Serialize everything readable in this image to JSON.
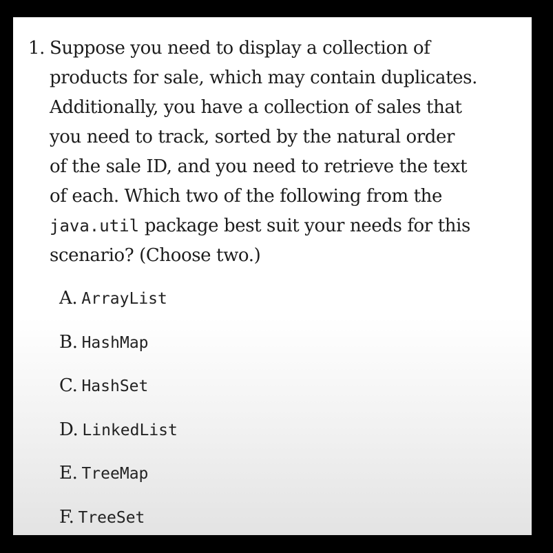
{
  "question": {
    "number": "1.",
    "lines": [
      "Suppose you need to display a collection of",
      "products for sale, which may contain duplicates.",
      "Additionally, you have a collection of sales that",
      "you need to track, sorted by the natural order",
      "of the sale ID, and you need to retrieve the text",
      "of each. Which two of the following from the"
    ],
    "package_code": "java.util",
    "package_rest": " package best suit your needs for this",
    "last_line": "scenario? (Choose two.)"
  },
  "options": [
    {
      "letter": "A.",
      "text": "ArrayList"
    },
    {
      "letter": "B.",
      "text": "HashMap"
    },
    {
      "letter": "C.",
      "text": "HashSet"
    },
    {
      "letter": "D.",
      "text": "LinkedList"
    },
    {
      "letter": "E.",
      "text": "TreeMap"
    },
    {
      "letter": "F.",
      "text": "TreeSet"
    }
  ]
}
